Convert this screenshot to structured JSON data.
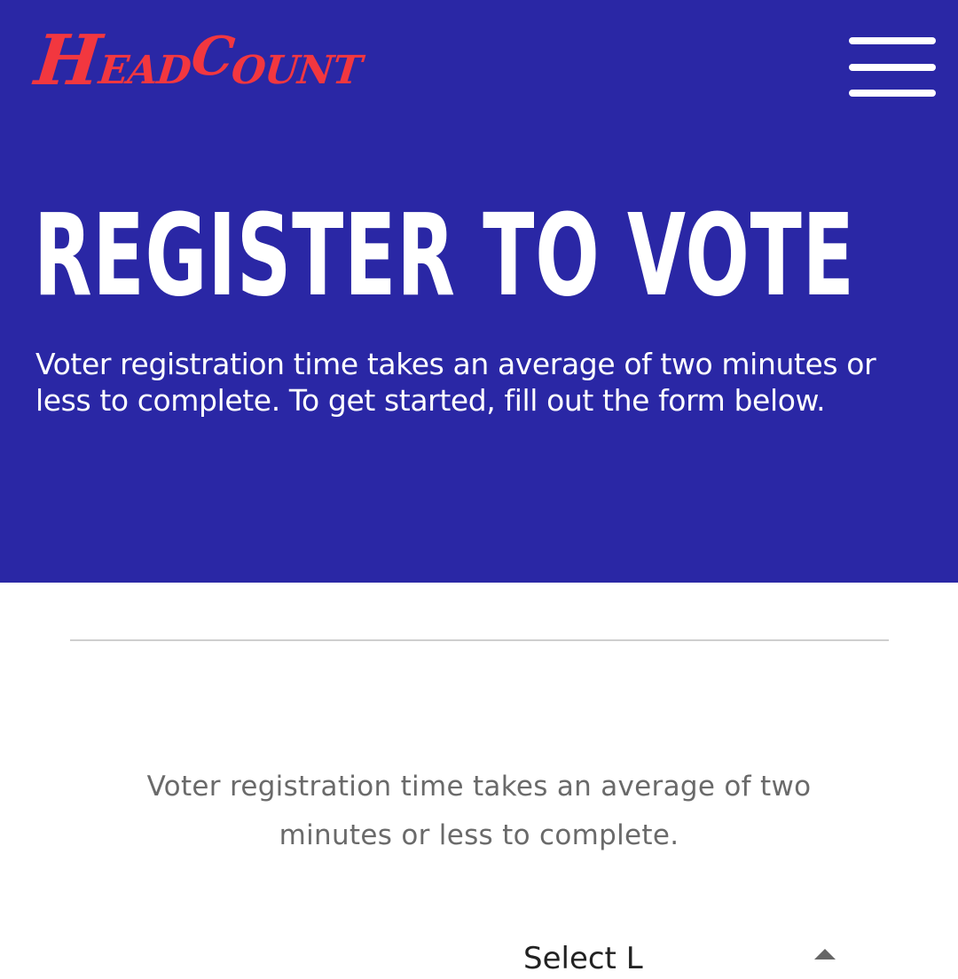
{
  "header": {
    "logo_parts": [
      "H",
      "EAD",
      "C",
      "OUNT"
    ],
    "menu_icon": "hamburger-menu-icon",
    "background_color": "#2a27a5",
    "logo_color": "#f2373f"
  },
  "hero": {
    "title": "REGISTER TO VOTE",
    "description": "Voter registration time takes an average of two minutes or less to complete. To get started, fill out the form below."
  },
  "form": {
    "intro": "Voter registration time takes an average of two minutes or less to complete.",
    "state_select": {
      "selected_value": "Select L",
      "icon": "select-arrow-icon"
    }
  }
}
